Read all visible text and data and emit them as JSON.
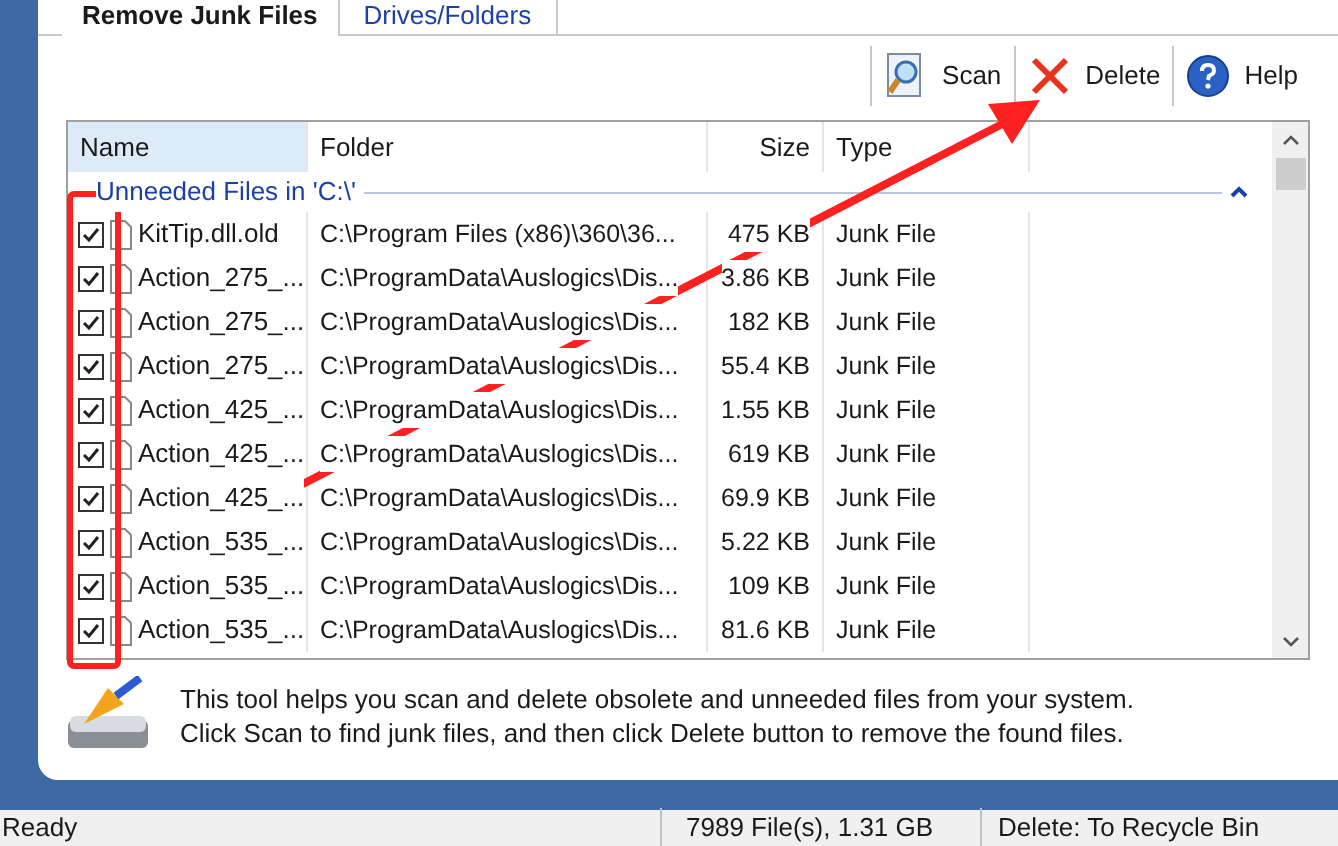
{
  "tabs": [
    {
      "label": "Remove Junk Files",
      "selected": true
    },
    {
      "label": "Drives/Folders",
      "selected": false
    }
  ],
  "toolbar": [
    {
      "kind": "scan",
      "label": "Scan"
    },
    {
      "kind": "delete",
      "label": "Delete"
    },
    {
      "kind": "help",
      "label": "Help"
    }
  ],
  "table": {
    "columns": [
      "Name",
      "Folder",
      "Size",
      "Type"
    ],
    "group": "Unneeded Files in 'C:\\'",
    "rows": [
      {
        "checked": true,
        "name": "KitTip.dll.old",
        "folder": "C:\\Program Files (x86)\\360\\36...",
        "size": "475 KB",
        "type": "Junk File"
      },
      {
        "checked": true,
        "name": "Action_275_...",
        "folder": "C:\\ProgramData\\Auslogics\\Dis...",
        "size": "3.86 KB",
        "type": "Junk File"
      },
      {
        "checked": true,
        "name": "Action_275_...",
        "folder": "C:\\ProgramData\\Auslogics\\Dis...",
        "size": "182 KB",
        "type": "Junk File"
      },
      {
        "checked": true,
        "name": "Action_275_...",
        "folder": "C:\\ProgramData\\Auslogics\\Dis...",
        "size": "55.4 KB",
        "type": "Junk File"
      },
      {
        "checked": true,
        "name": "Action_425_...",
        "folder": "C:\\ProgramData\\Auslogics\\Dis...",
        "size": "1.55 KB",
        "type": "Junk File"
      },
      {
        "checked": true,
        "name": "Action_425_...",
        "folder": "C:\\ProgramData\\Auslogics\\Dis...",
        "size": "619 KB",
        "type": "Junk File"
      },
      {
        "checked": true,
        "name": "Action_425_...",
        "folder": "C:\\ProgramData\\Auslogics\\Dis...",
        "size": "69.9 KB",
        "type": "Junk File"
      },
      {
        "checked": true,
        "name": "Action_535_...",
        "folder": "C:\\ProgramData\\Auslogics\\Dis...",
        "size": "5.22 KB",
        "type": "Junk File"
      },
      {
        "checked": true,
        "name": "Action_535_...",
        "folder": "C:\\ProgramData\\Auslogics\\Dis...",
        "size": "109 KB",
        "type": "Junk File"
      },
      {
        "checked": true,
        "name": "Action_535_...",
        "folder": "C:\\ProgramData\\Auslogics\\Dis...",
        "size": "81.6 KB",
        "type": "Junk File"
      }
    ]
  },
  "description": [
    "This tool helps you scan and delete obsolete and unneeded files from your system.",
    "Click Scan to find junk files, and then click Delete button to remove the found files."
  ],
  "status_bar": [
    "Ready",
    "7989 File(s), 1.31 GB",
    "Delete: To Recycle Bin"
  ]
}
